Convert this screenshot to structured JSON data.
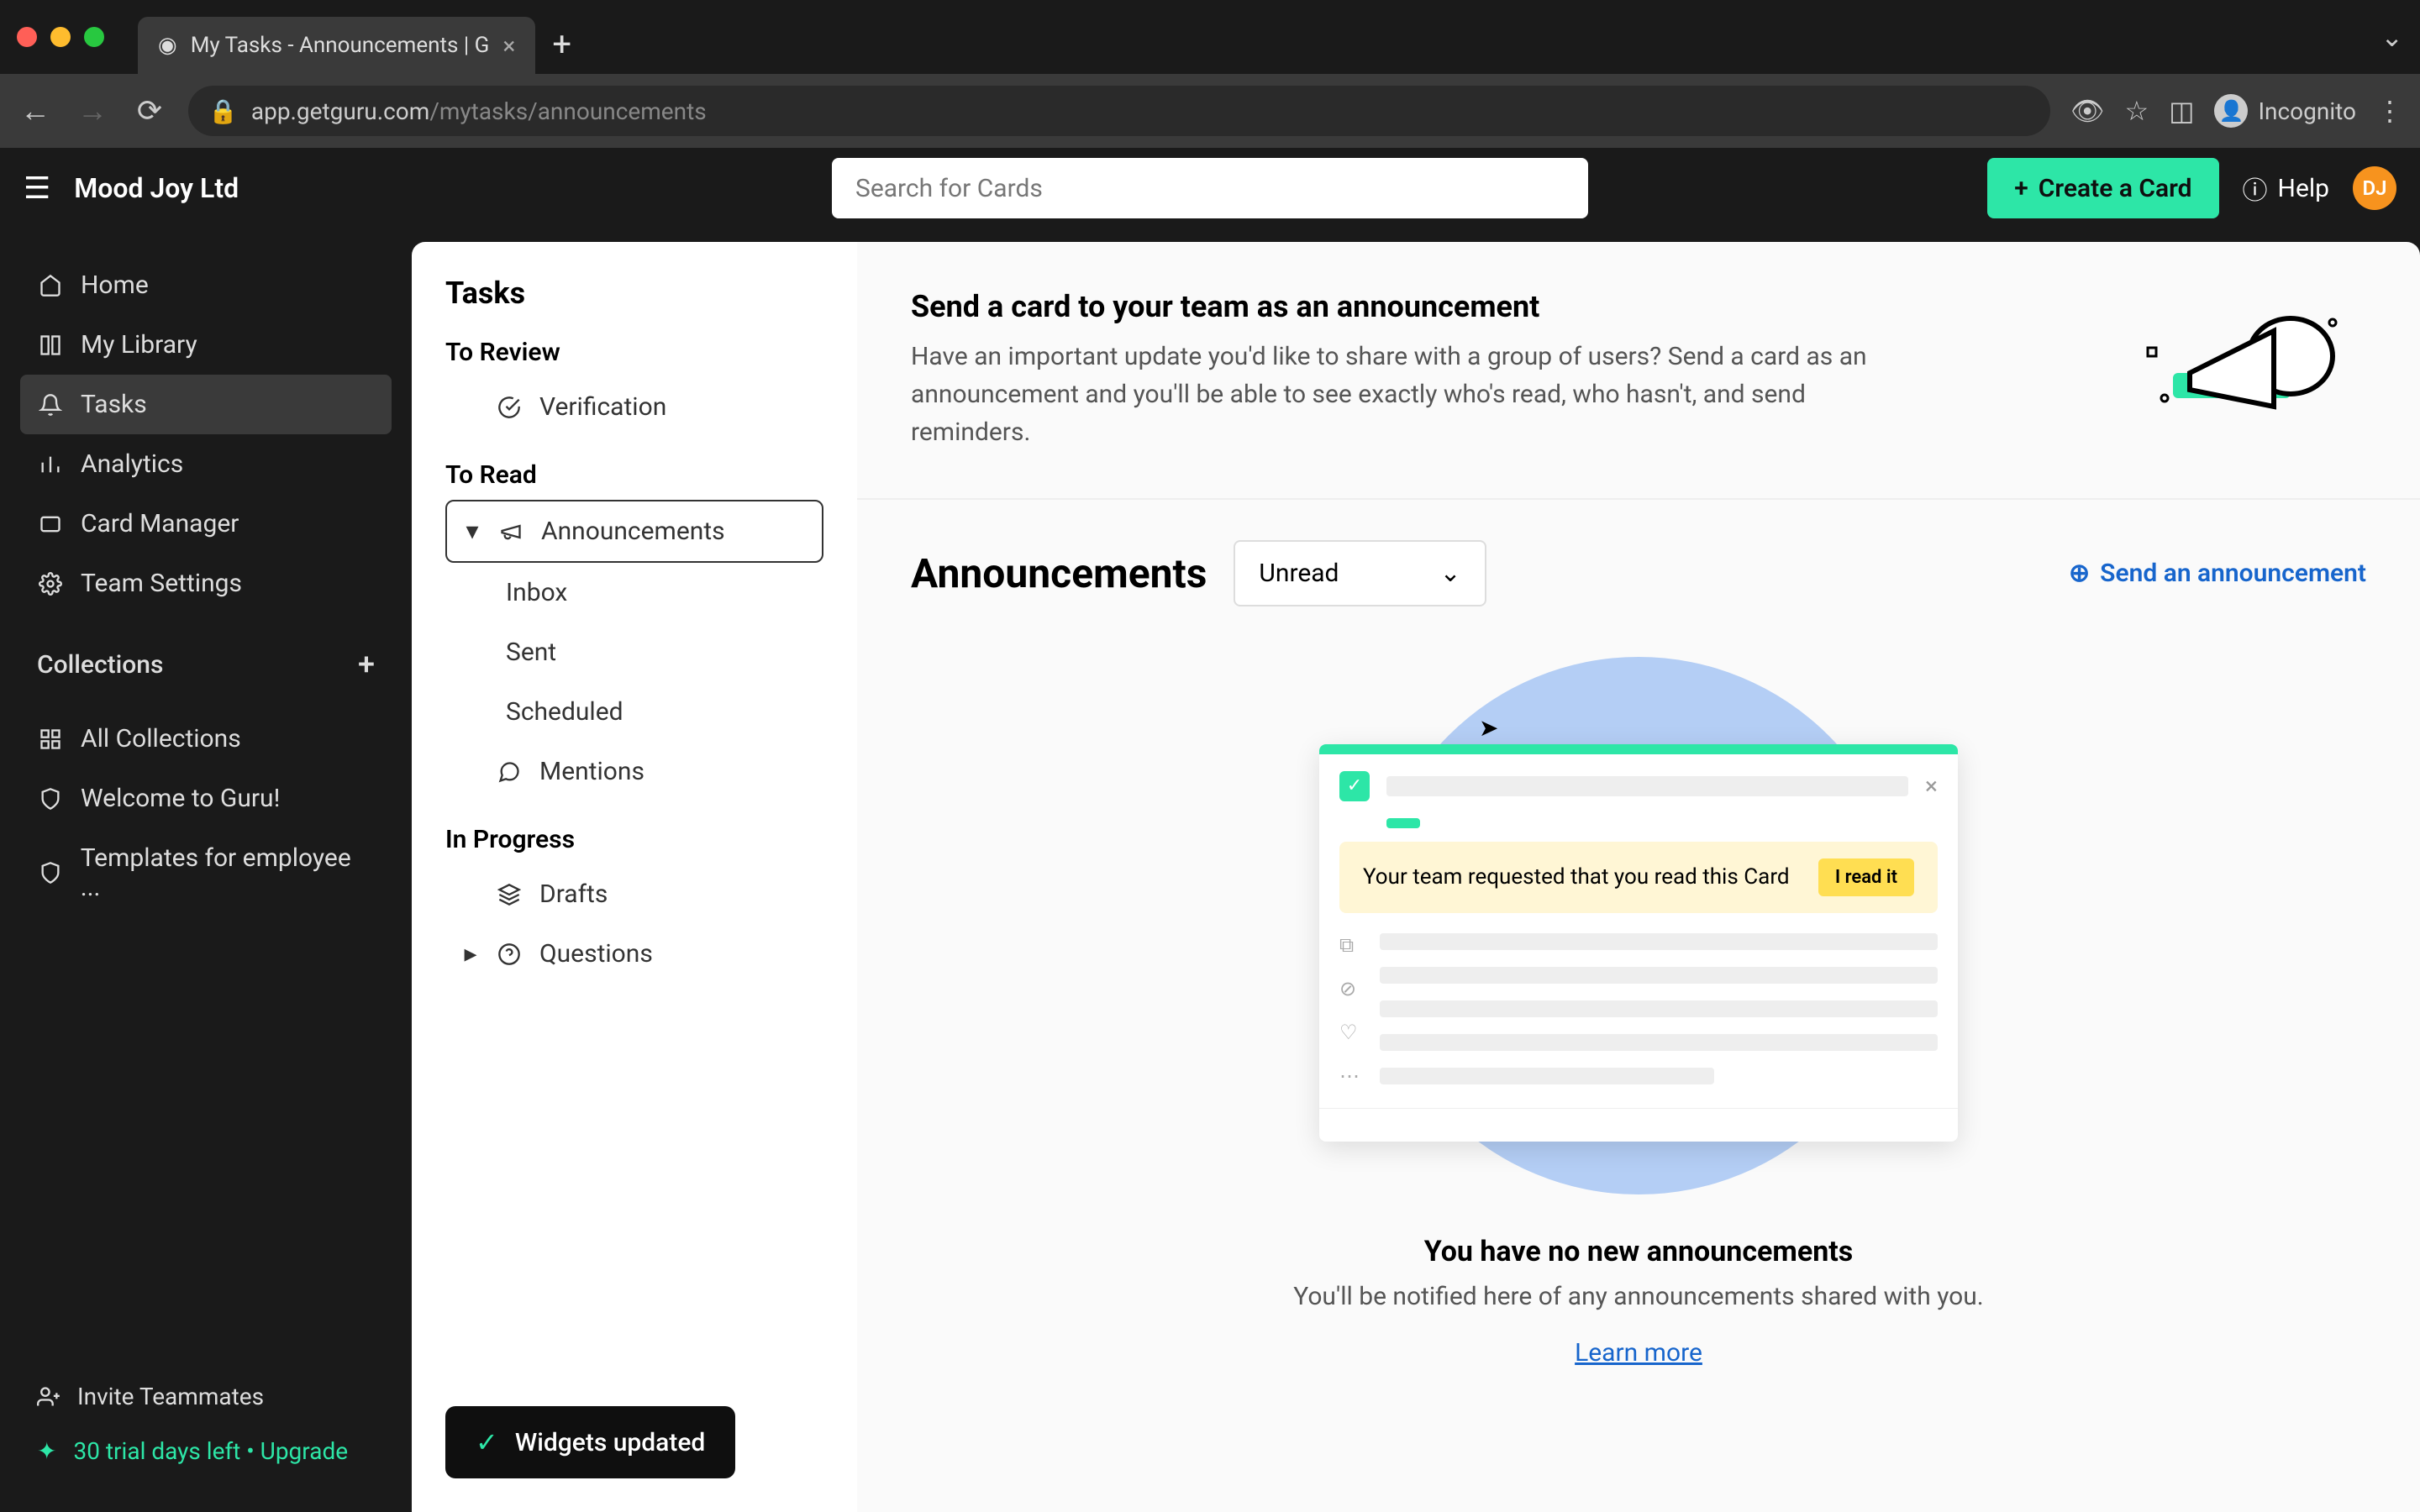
{
  "browser": {
    "tab_title": "My Tasks - Announcements | G",
    "url_host": "app.getguru.com",
    "url_path": "/mytasks/announcements",
    "incognito": "Incognito"
  },
  "topbar": {
    "workspace": "Mood Joy Ltd",
    "search_placeholder": "Search for Cards",
    "create_card": "Create a Card",
    "help": "Help",
    "avatar_initials": "DJ"
  },
  "sidebar": {
    "items": [
      {
        "label": "Home",
        "icon": "home-icon"
      },
      {
        "label": "My Library",
        "icon": "library-icon"
      },
      {
        "label": "Tasks",
        "icon": "bell-icon",
        "active": true
      },
      {
        "label": "Analytics",
        "icon": "analytics-icon"
      },
      {
        "label": "Card Manager",
        "icon": "card-manager-icon"
      },
      {
        "label": "Team Settings",
        "icon": "settings-icon"
      }
    ],
    "collections_header": "Collections",
    "collections": [
      {
        "label": "All Collections",
        "icon": "grid-icon"
      },
      {
        "label": "Welcome to Guru!",
        "icon": "shield-icon"
      },
      {
        "label": "Templates for employee ...",
        "icon": "shield-icon"
      }
    ],
    "footer": {
      "invite": "Invite Teammates",
      "trial": "30 trial days left • Upgrade"
    }
  },
  "tasks_panel": {
    "title": "Tasks",
    "sections": {
      "to_review": {
        "title": "To Review",
        "items": [
          {
            "label": "Verification",
            "icon": "check-circle-icon"
          }
        ]
      },
      "to_read": {
        "title": "To Read",
        "items": [
          {
            "label": "Announcements",
            "icon": "megaphone-icon",
            "expanded": true,
            "selected": true,
            "children": [
              {
                "label": "Inbox"
              },
              {
                "label": "Sent"
              },
              {
                "label": "Scheduled"
              }
            ]
          },
          {
            "label": "Mentions",
            "icon": "comment-icon"
          }
        ]
      },
      "in_progress": {
        "title": "In Progress",
        "items": [
          {
            "label": "Drafts",
            "icon": "layers-icon"
          },
          {
            "label": "Questions",
            "icon": "question-icon",
            "expandable": true
          }
        ]
      }
    },
    "toast": "Widgets updated"
  },
  "main": {
    "hero": {
      "title": "Send a card to your team as an announcement",
      "description": "Have an important update you'd like to share with a group of users? Send a card as an announcement and you'll be able to see exactly who's read, who hasn't, and send reminders."
    },
    "content_title": "Announcements",
    "filter_value": "Unread",
    "send_link": "Send an announcement",
    "empty": {
      "banner_text": "Your team requested that you read this Card",
      "banner_button": "I read it",
      "title": "You have no new announcements",
      "description": "You'll be notified here of any announcements shared with you.",
      "learn_more": "Learn more"
    }
  }
}
